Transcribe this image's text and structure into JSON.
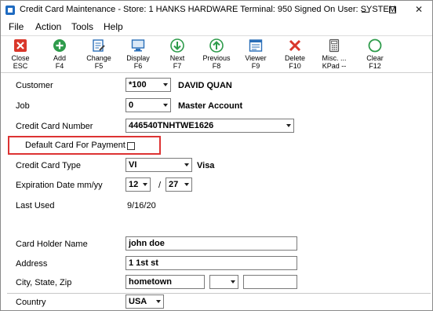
{
  "window": {
    "title": "Credit Card Maintenance - Store: 1   HANKS HARDWARE   Terminal: 950   Signed On User: SYSTEM",
    "min_glyph": "—",
    "max_glyph": "□",
    "close_glyph": "✕"
  },
  "menu": {
    "file": "File",
    "action": "Action",
    "tools": "Tools",
    "help": "Help"
  },
  "toolbar": {
    "close": {
      "label": "Close",
      "key": "ESC",
      "icon": "close-icon"
    },
    "add": {
      "label": "Add",
      "key": "F4",
      "icon": "add-icon"
    },
    "change": {
      "label": "Change",
      "key": "F5",
      "icon": "change-icon"
    },
    "display": {
      "label": "Display",
      "key": "F6",
      "icon": "display-icon"
    },
    "next": {
      "label": "Next",
      "key": "F7",
      "icon": "arrow-down-icon"
    },
    "previous": {
      "label": "Previous",
      "key": "F8",
      "icon": "arrow-up-icon"
    },
    "viewer": {
      "label": "Viewer",
      "key": "F9",
      "icon": "viewer-icon"
    },
    "delete": {
      "label": "Delete",
      "key": "F10",
      "icon": "delete-icon"
    },
    "misc": {
      "label": "Misc. ...",
      "key": "KPad --",
      "icon": "calculator-icon"
    },
    "clear": {
      "label": "Clear",
      "key": "F12",
      "icon": "clear-icon"
    }
  },
  "colors": {
    "close_red": "#d9372b",
    "green": "#2e9b4b",
    "blue": "#2a6fb8",
    "highlight": "#dd3333"
  },
  "form": {
    "customer": {
      "label": "Customer",
      "value": "*100",
      "name": "DAVID QUAN"
    },
    "job": {
      "label": "Job",
      "value": "0",
      "name": "Master Account"
    },
    "card_number": {
      "label": "Credit Card Number",
      "value": "446540TNHTWE1626"
    },
    "default_card": {
      "label": "Default Card For Payment",
      "checked": false
    },
    "card_type": {
      "label": "Credit Card Type",
      "value": "VI",
      "name": "Visa"
    },
    "expiration": {
      "label": "Expiration Date mm/yy",
      "month": "12",
      "separator": "/",
      "year": "27"
    },
    "last_used": {
      "label": "Last Used",
      "value": "9/16/20"
    },
    "holder_name": {
      "label": "Card Holder Name",
      "value": "john doe"
    },
    "address": {
      "label": "Address",
      "value": "1 1st st"
    },
    "city_state_zip": {
      "label": "City, State, Zip",
      "city": "hometown",
      "state": "",
      "zip": ""
    },
    "country": {
      "label": "Country",
      "value": "USA"
    }
  }
}
